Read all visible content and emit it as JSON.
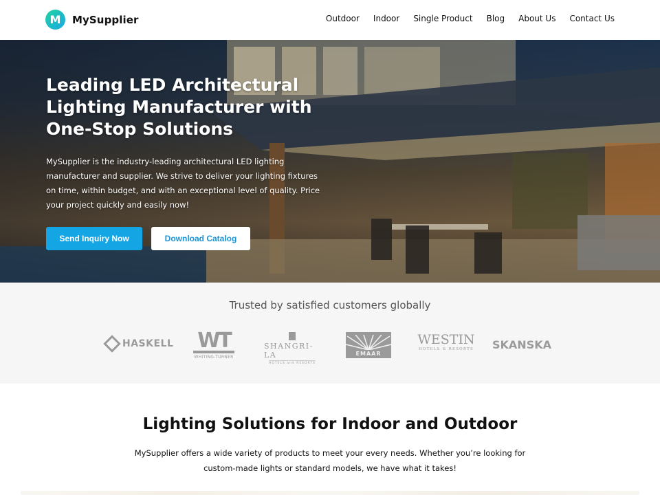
{
  "header": {
    "logo_letter": "M",
    "brand_name": "MySupplier",
    "nav": [
      "Outdoor",
      "Indoor",
      "Single Product",
      "Blog",
      "About Us",
      "Contact Us"
    ]
  },
  "hero": {
    "title": "Leading LED Architectural Lighting Manufacturer with One-Stop Solutions",
    "description": "MySupplier is the industry-leading architectural LED lighting manufacturer and supplier. We strive to deliver your lighting fixtures on time, within budget, and with an exceptional level of quality. Price your project quickly and easily now!",
    "primary_button": "Send Inquiry Now",
    "secondary_button": "Download Catalog",
    "colors": {
      "primary": "#13a5e4",
      "secondary_text": "#1a95d8"
    }
  },
  "trusted": {
    "title": "Trusted by satisfied customers globally",
    "logos": {
      "haskell": "HASKELL",
      "wt_mark": "WT",
      "wt_name": "WHITING-TURNER",
      "shangri_name": "SHANGRI-LA",
      "shangri_sub": "HOTELS and RESORTS",
      "emaar": "EMAAR",
      "westin_name": "WESTIN",
      "westin_sub": "HOTELS & RESORTS",
      "skanska": "SKANSKA"
    }
  },
  "solutions": {
    "title": "Lighting Solutions for Indoor and Outdoor",
    "description": "MySupplier offers a wide variety of products to meet your every needs. Whether you’re looking for custom-made lights or standard models, we have what it takes!"
  }
}
